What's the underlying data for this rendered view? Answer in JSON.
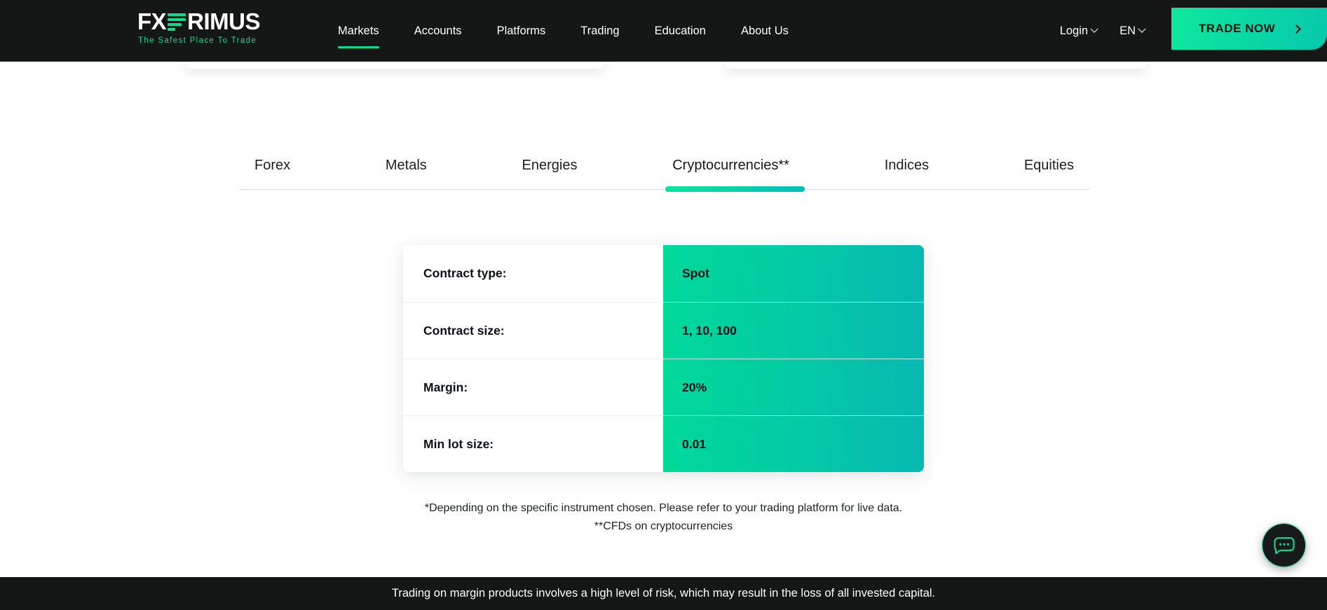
{
  "brand": {
    "logo_fx": "FX",
    "logo_rimus": "RIMUS",
    "tagline": "The Safest Place To Trade",
    "accent_green": "#14d98c",
    "accent_teal": "#07b8b2",
    "header_bg": "#141716"
  },
  "header": {
    "nav": [
      {
        "label": "Markets",
        "active": true
      },
      {
        "label": "Accounts",
        "active": false
      },
      {
        "label": "Platforms",
        "active": false
      },
      {
        "label": "Trading",
        "active": false
      },
      {
        "label": "Education",
        "active": false
      },
      {
        "label": "About Us",
        "active": false
      }
    ],
    "login_label": "Login",
    "language_label": "EN",
    "cta_label": "TRADE NOW"
  },
  "tabs": [
    {
      "label": "Forex",
      "active": false
    },
    {
      "label": "Metals",
      "active": false
    },
    {
      "label": "Energies",
      "active": false
    },
    {
      "label": "Cryptocurrencies**",
      "active": true
    },
    {
      "label": "Indices",
      "active": false
    },
    {
      "label": "Equities",
      "active": false
    }
  ],
  "spec_table": {
    "rows": [
      {
        "label": "Contract type:",
        "value": "Spot"
      },
      {
        "label": "Contract size:",
        "value": "1, 10, 100"
      },
      {
        "label": "Margin:",
        "value": "20%"
      },
      {
        "label": "Min lot size:",
        "value": "0.01"
      }
    ]
  },
  "footnotes": {
    "line1": "*Depending on the specific instrument chosen. Please refer to your trading platform for live data.",
    "line2": "**CFDs on cryptocurrencies"
  },
  "chat": {
    "icon": "chat-bubble-dots-icon"
  },
  "disclaimer": {
    "text": "Trading on margin products involves a high level of risk, which may result in the loss of all invested capital."
  }
}
